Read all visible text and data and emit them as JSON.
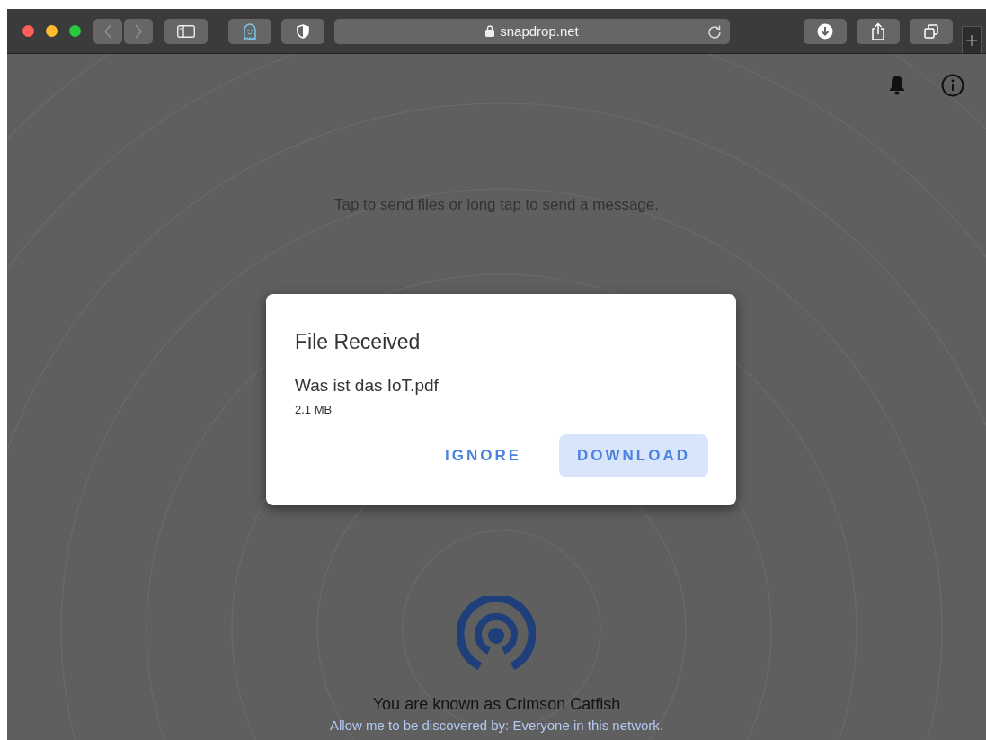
{
  "browser": {
    "url": "snapdrop.net"
  },
  "page": {
    "hint": "Tap to send files or long tap to send a message.",
    "dialog": {
      "title": "File Received",
      "file_name": "Was ist das IoT.pdf",
      "size": "2.1 MB",
      "buttons": [
        {
          "label": "IGNORE",
          "kind": "text"
        },
        {
          "label": "DOWNLOAD",
          "kind": "filled"
        }
      ]
    },
    "display_name": "You are known as Crimson Catfish",
    "discovery_link": "Allow me to be discovered by: Everyone in this network."
  }
}
